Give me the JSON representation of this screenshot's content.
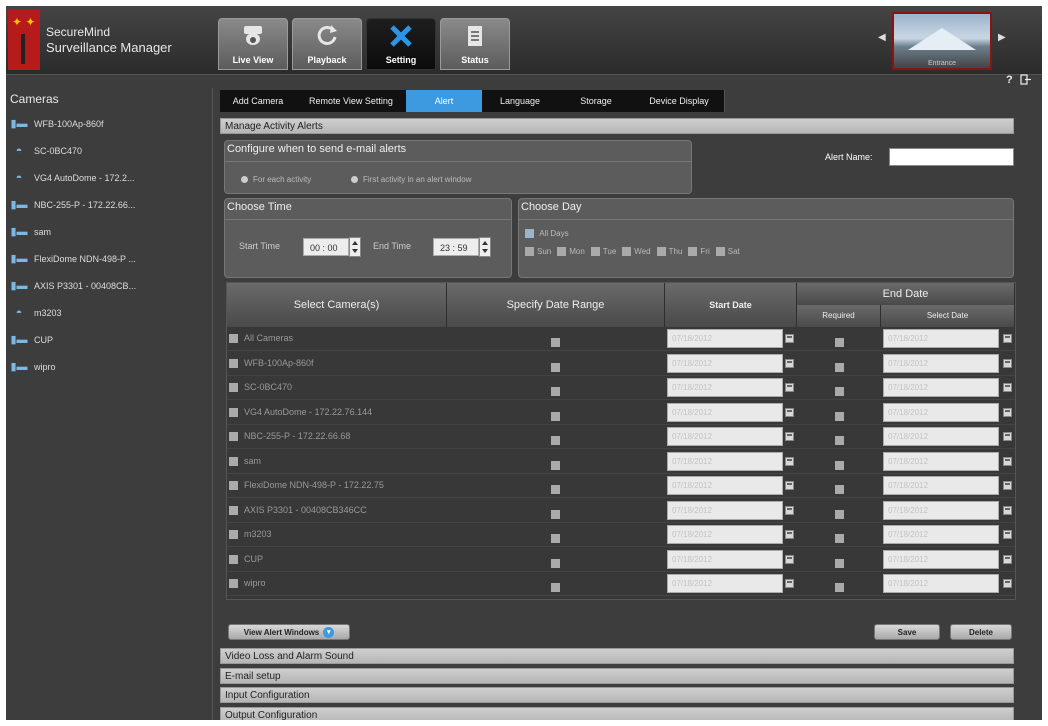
{
  "app": {
    "brand_line1": "SecureMind",
    "brand_line2": "Surveillance Manager"
  },
  "main_tabs": [
    {
      "label": "Live View",
      "icon": "camera-icon"
    },
    {
      "label": "Playback",
      "icon": "refresh-icon"
    },
    {
      "label": "Setting",
      "icon": "tools-icon"
    },
    {
      "label": "Status",
      "icon": "document-icon"
    }
  ],
  "preview": {
    "caption": "Entrance"
  },
  "toolbar": {
    "help": "?"
  },
  "sidebar": {
    "title": "Cameras",
    "cameras": [
      {
        "name": "WFB-100Ap-860f",
        "icon": "box-camera-icon"
      },
      {
        "name": "SC-0BC470",
        "icon": "dome-camera-icon"
      },
      {
        "name": "VG4 AutoDome - 172.2...",
        "icon": "dome-camera-icon"
      },
      {
        "name": "NBC-255-P - 172.22.66...",
        "icon": "box-camera-icon"
      },
      {
        "name": "sam",
        "icon": "box-camera-icon"
      },
      {
        "name": "FlexiDome NDN-498-P ...",
        "icon": "box-camera-icon"
      },
      {
        "name": "AXIS P3301 - 00408CB...",
        "icon": "box-camera-icon"
      },
      {
        "name": "m3203",
        "icon": "dome-camera-icon"
      },
      {
        "name": "CUP",
        "icon": "box-camera-icon"
      },
      {
        "name": "wipro",
        "icon": "box-camera-icon"
      }
    ]
  },
  "sub_tabs": [
    "Add Camera",
    "Remote View Setting",
    "Alert",
    "Language",
    "Storage",
    "Device Display"
  ],
  "alerts": {
    "section_title": "Manage Activity Alerts",
    "configure_title": "Configure when to send e-mail alerts",
    "option_each": "For each activity",
    "option_first": "First activity in an alert window",
    "alert_name_label": "Alert Name:",
    "alert_name_value": "",
    "choose_time_title": "Choose Time",
    "start_time_label": "Start Time",
    "start_time_value": "00 : 00",
    "end_time_label": "End Time",
    "end_time_value": "23 : 59",
    "choose_day_title": "Choose Day",
    "all_days": "All Days",
    "days": [
      "Sun",
      "Mon",
      "Tue",
      "Wed",
      "Thu",
      "Fri",
      "Sat"
    ]
  },
  "table": {
    "col_camera": "Select Camera(s)",
    "col_range": "Specify Date Range",
    "col_start": "Start Date",
    "col_end": "End Date",
    "col_required": "Required",
    "col_select": "Select Date",
    "rows": [
      {
        "name": "All Cameras",
        "start": "07/18/2012",
        "end": "07/18/2012"
      },
      {
        "name": "WFB-100Ap-860f",
        "start": "07/18/2012",
        "end": "07/18/2012"
      },
      {
        "name": "SC-0BC470",
        "start": "07/18/2012",
        "end": "07/18/2012"
      },
      {
        "name": "VG4 AutoDome - 172.22.76.144",
        "start": "07/18/2012",
        "end": "07/18/2012"
      },
      {
        "name": "NBC-255-P - 172.22.66.68",
        "start": "07/18/2012",
        "end": "07/18/2012"
      },
      {
        "name": "sam",
        "start": "07/18/2012",
        "end": "07/18/2012"
      },
      {
        "name": "FlexiDome NDN-498-P - 172.22.75",
        "start": "07/18/2012",
        "end": "07/18/2012"
      },
      {
        "name": "AXIS P3301 - 00408CB346CC",
        "start": "07/18/2012",
        "end": "07/18/2012"
      },
      {
        "name": "m3203",
        "start": "07/18/2012",
        "end": "07/18/2012"
      },
      {
        "name": "CUP",
        "start": "07/18/2012",
        "end": "07/18/2012"
      },
      {
        "name": "wipro",
        "start": "07/18/2012",
        "end": "07/18/2012"
      }
    ]
  },
  "buttons": {
    "view_alert_windows": "View Alert Windows",
    "save": "Save",
    "delete": "Delete"
  },
  "sections": [
    "Video Loss and Alarm Sound",
    "E-mail setup",
    "Input Configuration",
    "Output Configuration"
  ]
}
